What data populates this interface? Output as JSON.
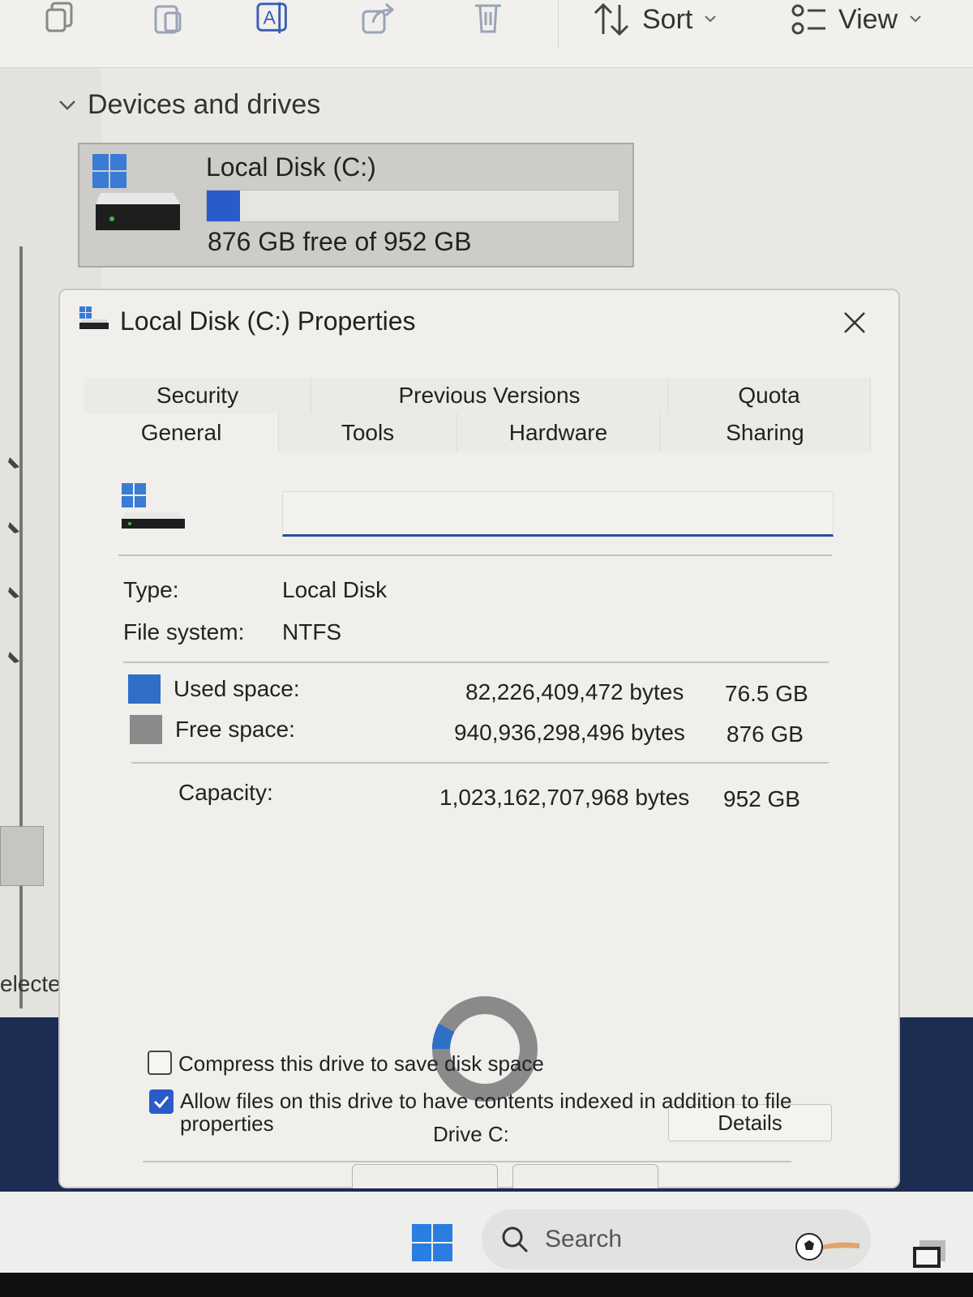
{
  "toolbar": {
    "sort_label": "Sort",
    "view_label": "View",
    "icons": [
      "copy-icon",
      "paste-icon",
      "rename-icon",
      "share-icon",
      "delete-icon",
      "sort-icon",
      "view-icon"
    ]
  },
  "nav": {
    "status_text": "elected"
  },
  "explorer": {
    "section_title": "Devices and drives",
    "drive": {
      "name": "Local Disk (C:)",
      "free_text": "876 GB free of 952 GB",
      "used_fraction": 0.08
    }
  },
  "dialog": {
    "title": "Local Disk (C:) Properties",
    "tabs_row1": [
      "Security",
      "Previous Versions",
      "Quota"
    ],
    "tabs_row2": [
      "General",
      "Tools",
      "Hardware",
      "Sharing"
    ],
    "active_tab": "General",
    "name_value": "",
    "type_label": "Type:",
    "type_value": "Local Disk",
    "fs_label": "File system:",
    "fs_value": "NTFS",
    "used_label": "Used space:",
    "used_bytes": "82,226,409,472 bytes",
    "used_size": "76.5 GB",
    "free_label": "Free space:",
    "free_bytes": "940,936,298,496 bytes",
    "free_size": "876 GB",
    "capacity_label": "Capacity:",
    "capacity_bytes": "1,023,162,707,968 bytes",
    "capacity_size": "952 GB",
    "drive_label": "Drive C:",
    "details_button": "Details",
    "compress_label": "Compress this drive to save disk space",
    "compress_checked": false,
    "index_label": "Allow files on this drive to have contents indexed in addition to file properties",
    "index_checked": true,
    "used_color": "#2f6fc8",
    "free_color": "#8a8a8a"
  },
  "taskbar": {
    "search_placeholder": "Search"
  }
}
